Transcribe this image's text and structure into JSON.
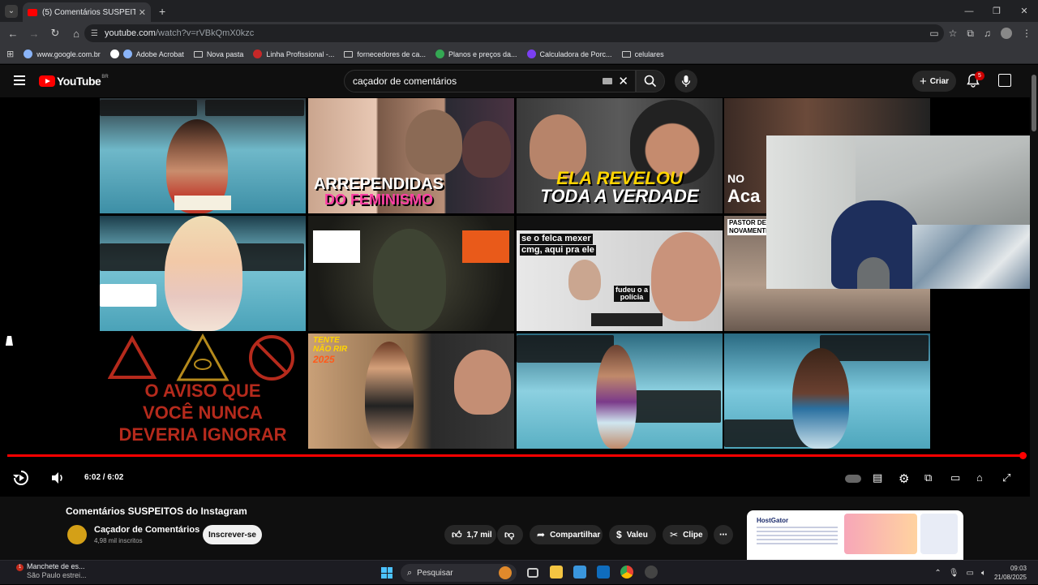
{
  "browser": {
    "tab_title": "(5) Comentários SUSPEITOS do Instagram",
    "url_host": "youtube.com",
    "url_path": "/watch?v=rVBkQmX0kzc",
    "bookmarks": [
      {
        "label": "www.google.com.br",
        "icon": "globe-icon"
      },
      {
        "label": "",
        "icon": "google-icon"
      },
      {
        "label": "Adobe Acrobat",
        "icon": "globe-icon"
      },
      {
        "label": "Nova pasta",
        "icon": "folder-icon"
      },
      {
        "label": "Linha Profissional -...",
        "icon": "folder-icon"
      },
      {
        "label": "fornecedores de ca...",
        "icon": "folder-icon"
      },
      {
        "label": "Planos e preços da...",
        "icon": "leaf-icon"
      },
      {
        "label": "Calculadora de Porc...",
        "icon": "calc-icon"
      },
      {
        "label": "celulares",
        "icon": "folder-icon"
      }
    ]
  },
  "youtube": {
    "logo_text": "YouTube",
    "region": "BR",
    "search_value": "caçador de comentários",
    "create_label": "Criar",
    "notification_count": "5"
  },
  "video": {
    "time_display": "6:02 / 6:02",
    "progress_fraction": 1.0,
    "thumbnails": [
      {
        "caption": ""
      },
      {
        "caption": "ARREPENDIDAS",
        "caption2": "DO FEMINISMO"
      },
      {
        "caption": "ELA REVELOU",
        "caption2": "TODA A VERDADE"
      },
      {
        "caption": "NO",
        "caption2": "Aca"
      },
      {
        "caption": ""
      },
      {
        "caption": "B",
        "caption2": "7"
      },
      {
        "caption": "se o felca mexer",
        "caption2": "cmg, aqui pra ele",
        "caption3": "fudeu o a polícia"
      },
      {
        "caption": "PASTOR DE",
        "caption2": "NOVAMENTE"
      },
      {
        "caption": "O AVISO QUE",
        "caption2": "VOCÊ NUNCA",
        "caption3": "DEVERIA IGNORAR"
      },
      {
        "caption": "TENTE",
        "caption2": "NÃO RIR",
        "caption3": "2025"
      },
      {
        "caption": ""
      },
      {
        "caption": ""
      }
    ]
  },
  "meta": {
    "title": "Comentários SUSPEITOS do Instagram",
    "channel_name": "Caçador de Comentários",
    "subscribers": "4,98 mil inscritos",
    "subscribe_label": "Inscrever-se",
    "likes": "1,7 mil",
    "share_label": "Compartilhar",
    "thanks_label": "Valeu",
    "clip_label": "Clipe",
    "ad_brand": "HostGator"
  },
  "taskbar": {
    "news_title": "Manchete de es...",
    "news_sub": "São Paulo estrei...",
    "search_placeholder": "Pesquisar",
    "time": "09:03",
    "date": "21/08/2025"
  },
  "colors": {
    "youtube_red": "#ff0000",
    "bg": "#0f0f0f",
    "chrome_bg": "#35363a"
  }
}
